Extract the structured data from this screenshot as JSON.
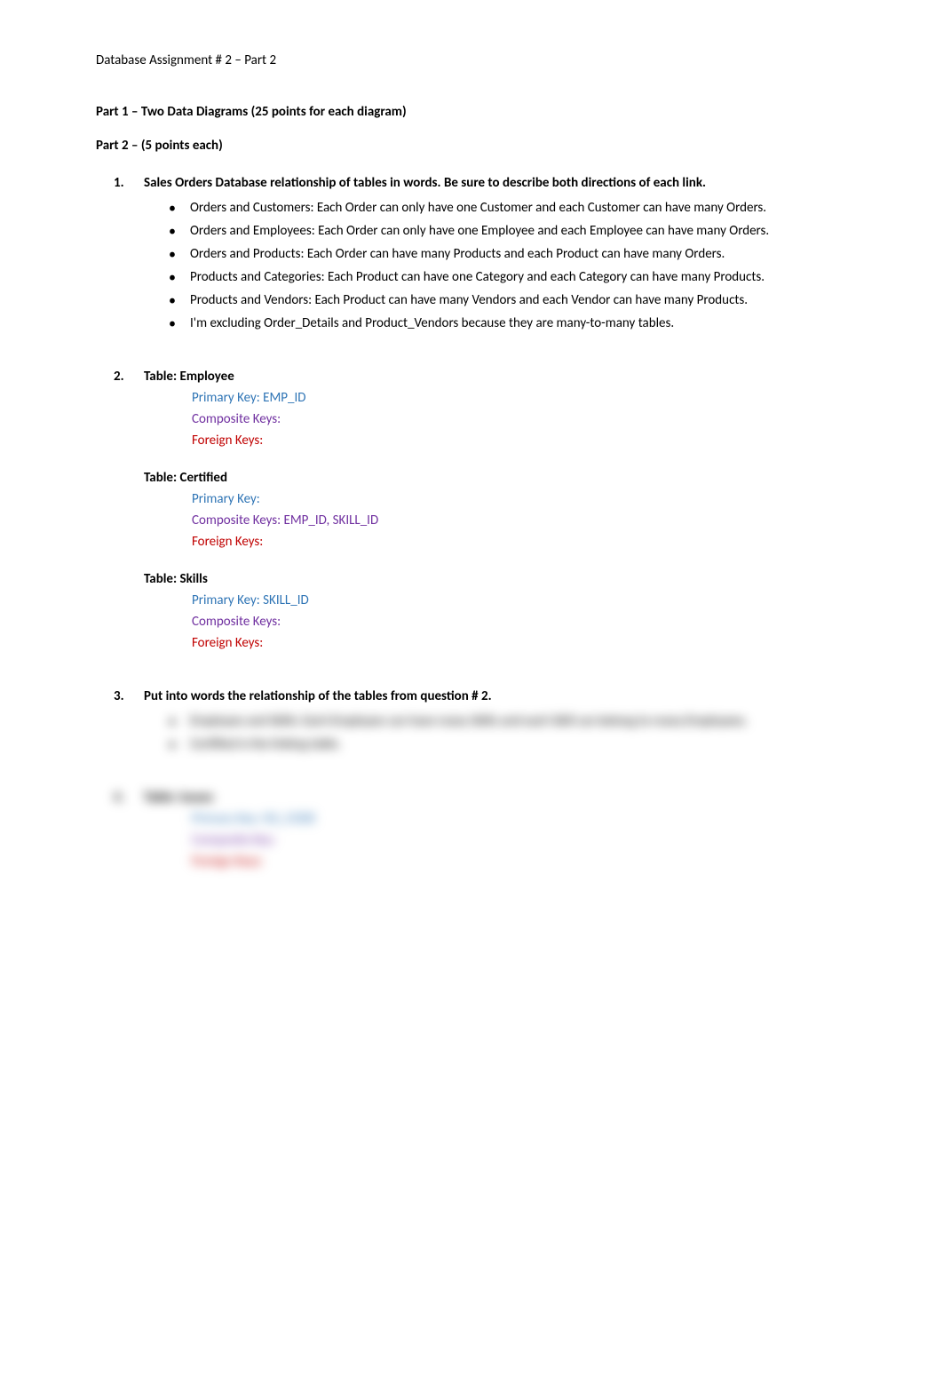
{
  "header": "Database Assignment # 2 – Part 2",
  "sections": {
    "part1": "Part 1 – Two Data Diagrams (25 points for each diagram)",
    "part2": "Part 2 – (5 points each)"
  },
  "q1": {
    "num": "1.",
    "title": "Sales Orders Database relationship of tables in words. Be sure to describe both directions of each link.",
    "bullets": [
      "Orders and Customers: Each Order can only have one Customer and each Customer can have many Orders.",
      "Orders and Employees: Each Order can only have one Employee and each Employee can have many Orders.",
      "Orders and Products: Each Order can have many Products and each Product can have many Orders.",
      "Products and Categories: Each Product can have one Category and each Category can have many Products.",
      "Products and Vendors: Each Product can have many Vendors and each Vendor can have many Products.",
      "I'm excluding Order_Details and Product_Vendors because they are many-to-many tables."
    ]
  },
  "q2": {
    "num": "2.",
    "tables": [
      {
        "title": "Table: Employee",
        "primary": "Primary Key: EMP_ID",
        "composite": "Composite Keys:",
        "foreign": "Foreign Keys:"
      },
      {
        "title": "Table: Certified",
        "primary": "Primary Key:",
        "composite": "Composite Keys: EMP_ID, SKILL_ID",
        "foreign": "Foreign Keys:"
      },
      {
        "title": "Table: Skills",
        "primary": "Primary Key: SKILL_ID",
        "composite": "Composite Keys:",
        "foreign": "Foreign Keys:"
      }
    ]
  },
  "q3": {
    "num": "3.",
    "title": "Put into words the relationship of the tables from question # 2.",
    "blurred_bullets": [
      "Employee and Skills: Each Employee can have many Skills and each Skill can belong to many Employees.",
      "Certified is the linking table."
    ]
  },
  "q4": {
    "num": "4.",
    "title": "Table: Issues",
    "primary": "Primary Key: ISS_CODE",
    "composite": "Composite Key:",
    "foreign": "Foreign Keys:"
  }
}
